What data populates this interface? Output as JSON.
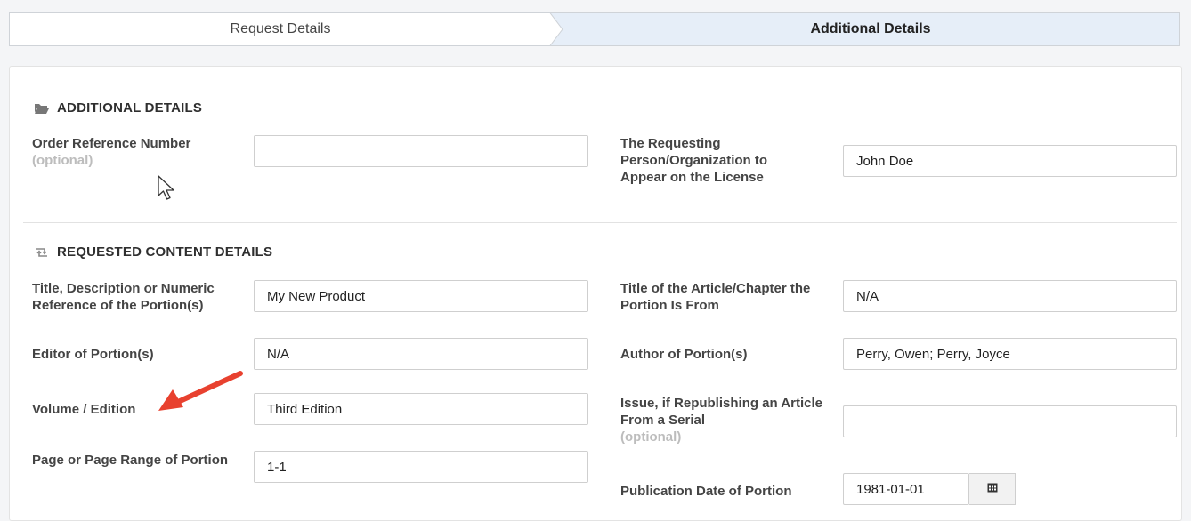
{
  "steps": {
    "step1": "Request Details",
    "step2": "Additional Details"
  },
  "additional": {
    "title": "ADDITIONAL DETAILS",
    "order_ref_label": "Order Reference Number",
    "order_ref_optional": "(optional)",
    "order_ref_value": "",
    "requester_label": "The Requesting Person/Organization to Appear on the License",
    "requester_value": "John Doe"
  },
  "content": {
    "title": "REQUESTED CONTENT DETAILS",
    "portion_title_label": "Title, Description or Numeric Reference of the Portion(s)",
    "portion_title_value": "My New Product",
    "article_title_label": "Title of the Article/Chapter the Portion Is From",
    "article_title_value": "N/A",
    "editor_label": "Editor of Portion(s)",
    "editor_value": "N/A",
    "author_label": "Author of Portion(s)",
    "author_value": "Perry, Owen; Perry, Joyce",
    "volume_label": "Volume / Edition",
    "volume_value": "Third Edition",
    "issue_label": "Issue, if Republishing an Article From a Serial",
    "issue_optional": "(optional)",
    "issue_value": "",
    "page_range_label": "Page or Page Range of Portion",
    "page_range_value": "1-1",
    "pub_date_label": "Publication Date of Portion",
    "pub_date_value": "1981-01-01"
  },
  "icons": {
    "folder": "folder-open-icon",
    "retweet": "retweet-icon",
    "calendar": "calendar-icon"
  },
  "colors": {
    "active_step": "#e6eef8",
    "annotation_arrow": "#e8412f"
  }
}
